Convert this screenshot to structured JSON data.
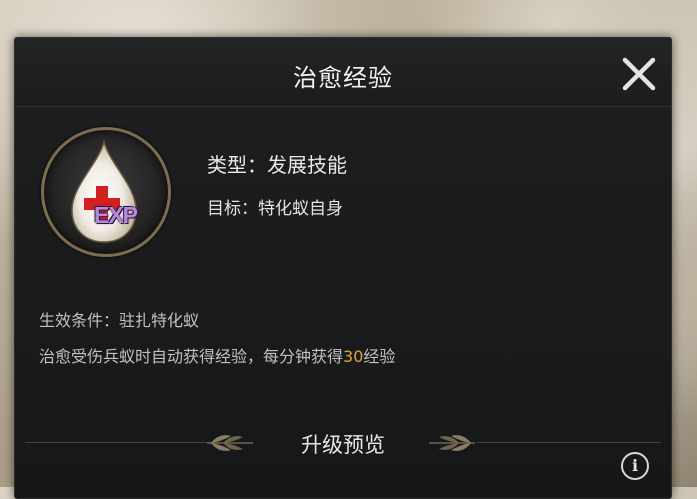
{
  "dialog": {
    "title": "治愈经验",
    "close_icon": "close-icon"
  },
  "skill": {
    "icon": "healing-drop-exp-icon",
    "icon_badge": "EXP",
    "type_line": "类型：发展技能",
    "target_line": "目标：特化蚁自身"
  },
  "details": {
    "condition": "生效条件：驻扎特化蚁",
    "desc_prefix": "治愈受伤兵蚁时自动获得经验，每分钟获得",
    "desc_value": "30",
    "desc_suffix": "经验"
  },
  "upgrade": {
    "title": "升级预览"
  },
  "info_button": {
    "label": "i",
    "icon": "info-icon"
  },
  "colors": {
    "highlight": "#e0a43a",
    "exp_text": "#b58ad8",
    "panel_bg": "#1e1f21",
    "ring_gold": "#7c6d4e"
  }
}
